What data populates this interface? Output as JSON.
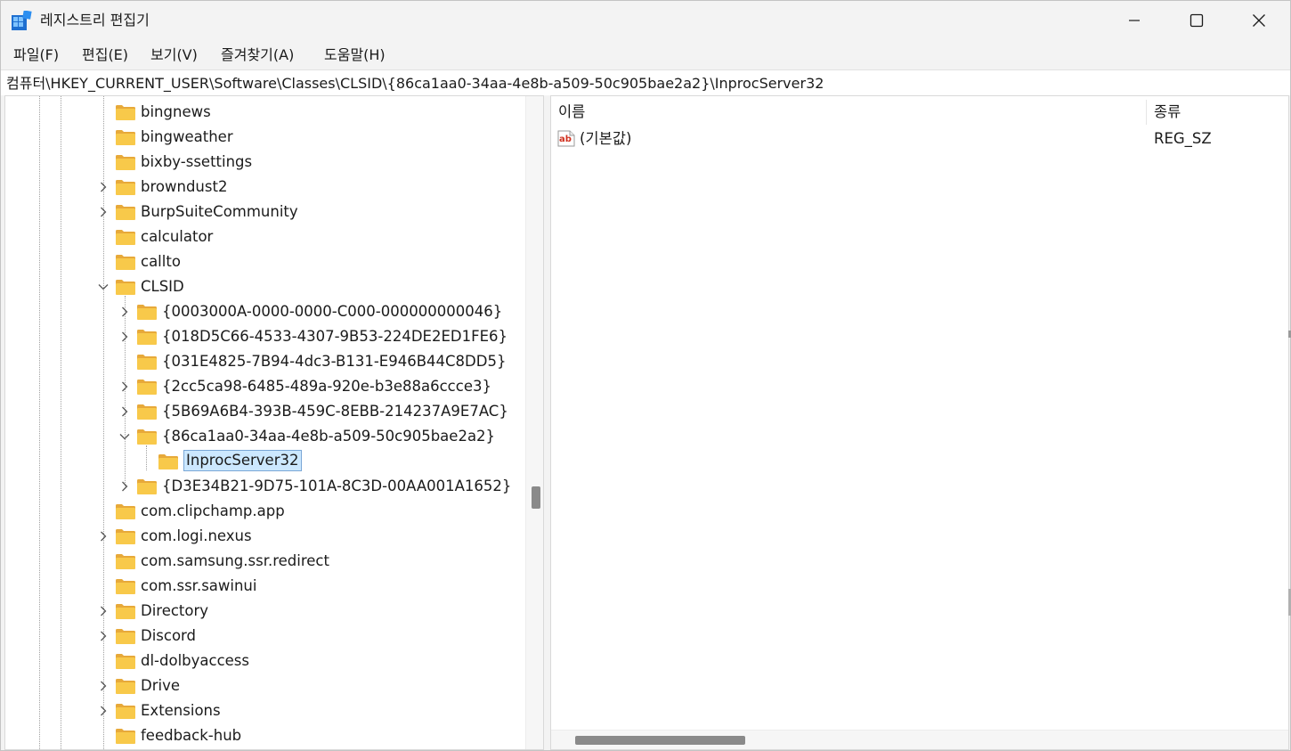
{
  "window": {
    "title": "레지스트리 편집기",
    "minimize_label": "Minimize",
    "maximize_label": "Maximize",
    "close_label": "Close"
  },
  "menu": {
    "items": [
      {
        "label": "파일(F)"
      },
      {
        "label": "편집(E)"
      },
      {
        "label": "보기(V)"
      },
      {
        "label": "즐겨찾기(A)"
      },
      {
        "label": "도움말(H)"
      }
    ]
  },
  "address": {
    "path": "컴퓨터\\HKEY_CURRENT_USER\\Software\\Classes\\CLSID\\{86ca1aa0-34aa-4e8b-a509-50c905bae2a2}\\InprocServer32"
  },
  "tree": {
    "items": [
      {
        "label": "bingnews",
        "level": 0,
        "expander": "none"
      },
      {
        "label": "bingweather",
        "level": 0,
        "expander": "none"
      },
      {
        "label": "bixby-ssettings",
        "level": 0,
        "expander": "none"
      },
      {
        "label": "browndust2",
        "level": 0,
        "expander": "collapsed"
      },
      {
        "label": "BurpSuiteCommunity",
        "level": 0,
        "expander": "collapsed"
      },
      {
        "label": "calculator",
        "level": 0,
        "expander": "none"
      },
      {
        "label": "callto",
        "level": 0,
        "expander": "none"
      },
      {
        "label": "CLSID",
        "level": 0,
        "expander": "expanded"
      },
      {
        "label": "{0003000A-0000-0000-C000-000000000046}",
        "level": 1,
        "expander": "collapsed"
      },
      {
        "label": "{018D5C66-4533-4307-9B53-224DE2ED1FE6}",
        "level": 1,
        "expander": "collapsed"
      },
      {
        "label": "{031E4825-7B94-4dc3-B131-E946B44C8DD5}",
        "level": 1,
        "expander": "none"
      },
      {
        "label": "{2cc5ca98-6485-489a-920e-b3e88a6ccce3}",
        "level": 1,
        "expander": "collapsed"
      },
      {
        "label": "{5B69A6B4-393B-459C-8EBB-214237A9E7AC}",
        "level": 1,
        "expander": "collapsed"
      },
      {
        "label": "{86ca1aa0-34aa-4e8b-a509-50c905bae2a2}",
        "level": 1,
        "expander": "expanded"
      },
      {
        "label": "InprocServer32",
        "level": 2,
        "expander": "none",
        "selected": true
      },
      {
        "label": "{D3E34B21-9D75-101A-8C3D-00AA001A1652}",
        "level": 1,
        "expander": "collapsed"
      },
      {
        "label": "com.clipchamp.app",
        "level": 0,
        "expander": "none"
      },
      {
        "label": "com.logi.nexus",
        "level": 0,
        "expander": "collapsed"
      },
      {
        "label": "com.samsung.ssr.redirect",
        "level": 0,
        "expander": "none"
      },
      {
        "label": "com.ssr.sawinui",
        "level": 0,
        "expander": "none"
      },
      {
        "label": "Directory",
        "level": 0,
        "expander": "collapsed"
      },
      {
        "label": "Discord",
        "level": 0,
        "expander": "collapsed"
      },
      {
        "label": "dl-dolbyaccess",
        "level": 0,
        "expander": "none"
      },
      {
        "label": "Drive",
        "level": 0,
        "expander": "collapsed"
      },
      {
        "label": "Extensions",
        "level": 0,
        "expander": "collapsed"
      },
      {
        "label": "feedback-hub",
        "level": 0,
        "expander": "none"
      }
    ]
  },
  "values": {
    "columns": {
      "name": "이름",
      "type": "종류"
    },
    "rows": [
      {
        "name": "(기본값)",
        "type": "REG_SZ",
        "icon": "string-value-icon"
      }
    ]
  },
  "colors": {
    "selection_bg": "#cce8ff",
    "selection_border": "#7aa7d6",
    "folder": "#f8c94a",
    "folder_dark": "#e7a93a",
    "value_icon": "#d0301e"
  }
}
